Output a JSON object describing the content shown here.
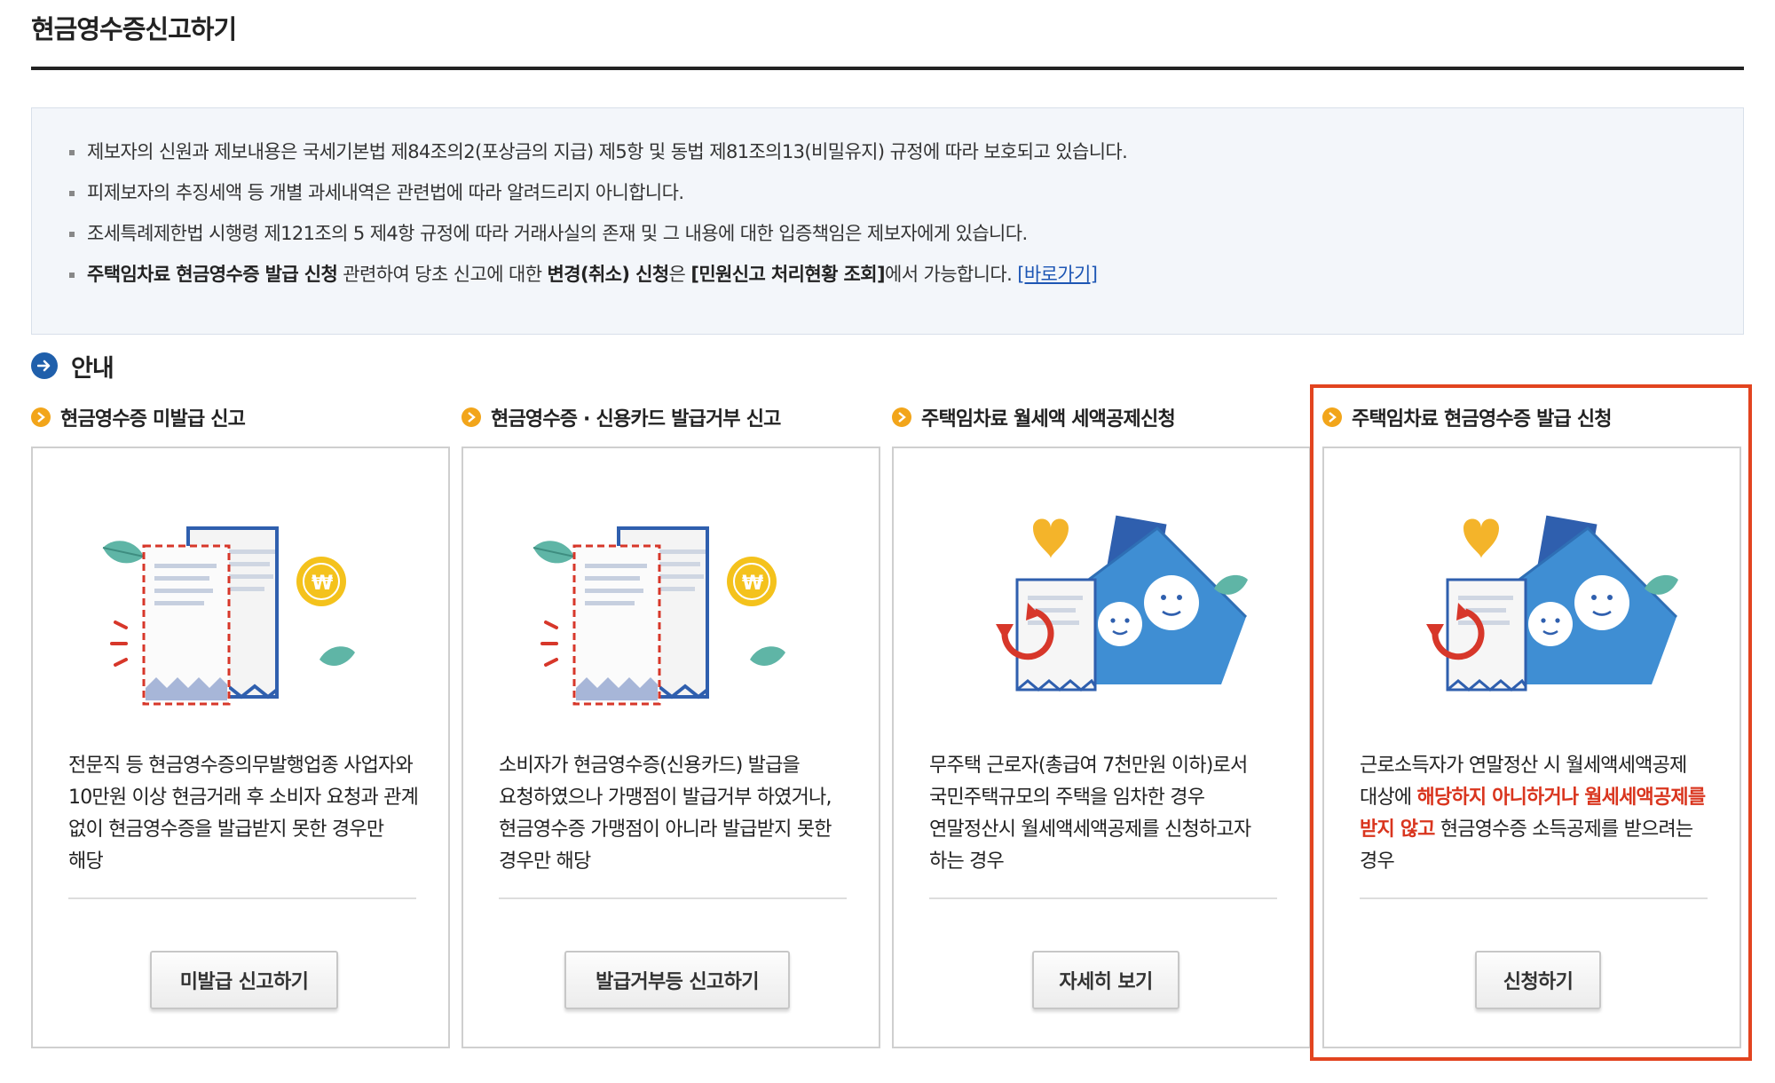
{
  "page": {
    "title": "현금영수증신고하기"
  },
  "notices": {
    "line1": "제보자의 신원과 제보내용은 국세기본법 제84조의2(포상금의 지급) 제5항 및 동법 제81조의13(비밀유지) 규정에 따라 보호되고 있습니다.",
    "line2": "피제보자의 추징세액 등 개별 과세내역은 관련법에 따라 알려드리지 아니합니다.",
    "line3": "조세특례제한법 시행령 제121조의 5 제4항 규정에 따라 거래사실의 존재 및 그 내용에 대한 입증책임은 제보자에게 있습니다.",
    "line4": {
      "bold1": "주택임차료 현금영수증 발급 신청",
      "text1": " 관련하여 당초 신고에 대한 ",
      "bold2": "변경(취소) 신청",
      "text2": "은 ",
      "bold3": "[민원신고 처리현황 조회]",
      "text3": "에서 가능합니다. ",
      "link": "[바로가기]"
    }
  },
  "info": {
    "title": "안내"
  },
  "cards": [
    {
      "heading": "현금영수증 미발급 신고",
      "desc": "전문직 등 현금영수증의무발행업종 사업자와 10만원 이상 현금거래 후 소비자 요청과 관계 없이 현금영수증을 발급받지 못한 경우만 해당",
      "button": "미발급 신고하기",
      "illustration": "receipt-coin-illustration"
    },
    {
      "heading": "현금영수증 · 신용카드 발급거부 신고",
      "desc": "소비자가 현금영수증(신용카드) 발급을 요청하였으나 가맹점이 발급거부 하였거나, 현금영수증 가맹점이 아니라 발급받지 못한 경우만 해당",
      "button": "발급거부등 신고하기",
      "illustration": "receipt-coin-illustration"
    },
    {
      "heading": "주택임차료 월세액 세액공제신청",
      "desc": "무주택 근로자(총급여 7천만원 이하)로서 국민주택규모의 주택을 임차한 경우 연말정산시 월세액세액공제를 신청하고자 하는 경우",
      "button": "자세히 보기",
      "illustration": "house-receipt-illustration"
    },
    {
      "heading": "주택임차료 현금영수증 발급 신청",
      "desc_pre": "근로소득자가 연말정산 시 월세액세액공제 대상에 ",
      "desc_red": "해당하지 아니하거나 월세세액공제를 받지 않고",
      "desc_post": " 현금영수증 소득공제를 받으려는 경우",
      "button": "신청하기",
      "illustration": "house-receipt-illustration"
    }
  ],
  "colors": {
    "highlight": "#e2441f",
    "emphasis_red": "#d9351e",
    "link_blue": "#1d56b4",
    "info_icon": "#1f5fab",
    "heading_dot": "#f2a51a",
    "notice_bg": "#f3f6fa"
  }
}
